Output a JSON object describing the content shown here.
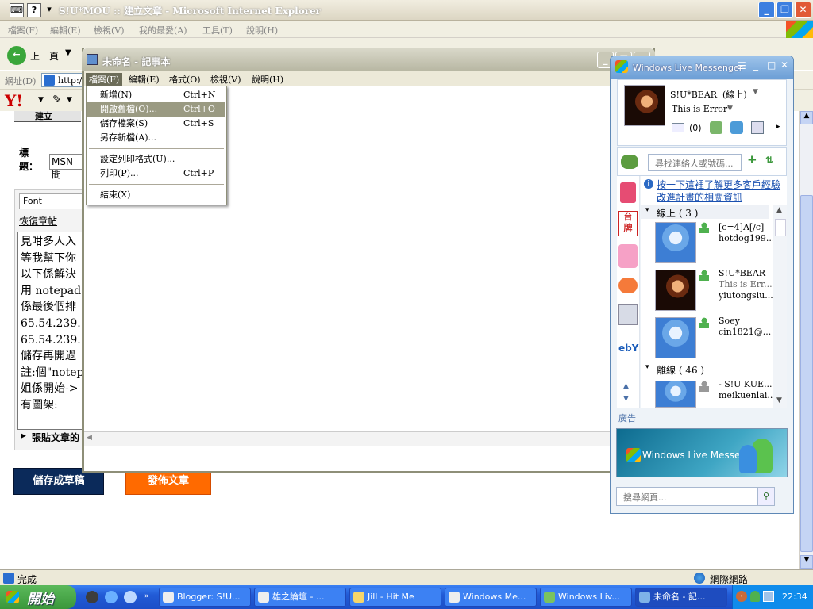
{
  "ie": {
    "title": "S!U*MOU :: 建立文章 - Microsoft Internet Explorer",
    "menu": [
      "檔案(F)",
      "編輯(E)",
      "檢視(V)",
      "我的最愛(A)",
      "工具(T)",
      "說明(H)"
    ],
    "back_label": "上一頁",
    "address_label": "網址(D)",
    "address_value": "http://",
    "status_text": "完成",
    "zone_text": "網際網路"
  },
  "editor": {
    "tab_label": "建立",
    "title_label": "標題：",
    "title_value": "MSN問",
    "font_select": "Font",
    "restore_link": "恢復章帖",
    "body_lines": [
      "見咁多人入",
      "等我幫下你",
      "以下係解決",
      "用 notepad",
      "係最後個排",
      "65.54.239.",
      "65.54.239.",
      "儲存再開過",
      "註:個\"notep",
      "姐係開始->",
      "有圖架:"
    ],
    "paste_section": "張貼文章的",
    "save_draft": "儲存成草稿",
    "publish": "發佈文章"
  },
  "notepad": {
    "title": "未命名 - 記事本",
    "menu": [
      {
        "label": "檔案(F)",
        "selected": true
      },
      {
        "label": "編輯(E)",
        "selected": false
      },
      {
        "label": "格式(O)",
        "selected": false
      },
      {
        "label": "檢視(V)",
        "selected": false
      },
      {
        "label": "說明(H)",
        "selected": false
      }
    ],
    "file_menu": [
      {
        "label": "新增(N)",
        "shortcut": "Ctrl+N",
        "highlight": false
      },
      {
        "label": "開啟舊檔(O)...",
        "shortcut": "Ctrl+O",
        "highlight": true
      },
      {
        "label": "儲存檔案(S)",
        "shortcut": "Ctrl+S",
        "highlight": false
      },
      {
        "label": "另存新檔(A)...",
        "shortcut": "",
        "highlight": false
      },
      {
        "label": "設定列印格式(U)...",
        "shortcut": "",
        "highlight": false
      },
      {
        "label": "列印(P)...",
        "shortcut": "Ctrl+P",
        "highlight": false
      },
      {
        "label": "結束(X)",
        "shortcut": "",
        "highlight": false
      }
    ]
  },
  "msn": {
    "title": "Windows Live Messenger",
    "user_name": "S!U*BEAR  (線上)",
    "personal_msg": "This is Error\"",
    "mail_count": "(0)",
    "search_placeholder": "尋找連絡人或號碼...",
    "info_link_1": "按一下這裡了解更多客戶經驗",
    "info_link_2": "改進計畫的相關資訊",
    "online_group": "線上 ( 3 )",
    "offline_group": "離線 ( 46 )",
    "contacts": [
      {
        "name": "[c=4]A[/c]",
        "msg": "",
        "email": "hotdog199..."
      },
      {
        "name": "S!U*BEAR",
        "msg": "This is Err...",
        "email": "yiutongsiu..."
      },
      {
        "name": "Soey",
        "msg": "",
        "email": "cin1821@..."
      },
      {
        "name": "- S!U KUE...",
        "msg": "",
        "email": "meikuenlai..."
      }
    ],
    "ad_label": "廣告",
    "banner_text": "Windows Live Messenger",
    "web_search_placeholder": "搜尋網頁...",
    "side_icons": [
      "taipai-icon",
      "loop-easy-icon",
      "english-icon",
      "calendar-icon",
      "ebay-icon"
    ]
  },
  "taskbar": {
    "start": "開始",
    "tasks": [
      {
        "label": "Blogger: S!U...",
        "active": false
      },
      {
        "label": "雄之論壇 - ...",
        "active": false
      },
      {
        "label": "Jill - Hit Me",
        "active": false
      },
      {
        "label": "Windows Me...",
        "active": false
      },
      {
        "label": "Windows Liv...",
        "active": false
      },
      {
        "label": "未命名 - 記...",
        "active": true
      }
    ],
    "clock": "22:34"
  },
  "colors": {
    "taskbar_blue": "#225bd6",
    "start_green": "#3a973a",
    "save_btn": "#0b2a5a",
    "publish_btn": "#ff6a00",
    "menu_highlight": "#9a9a82"
  }
}
